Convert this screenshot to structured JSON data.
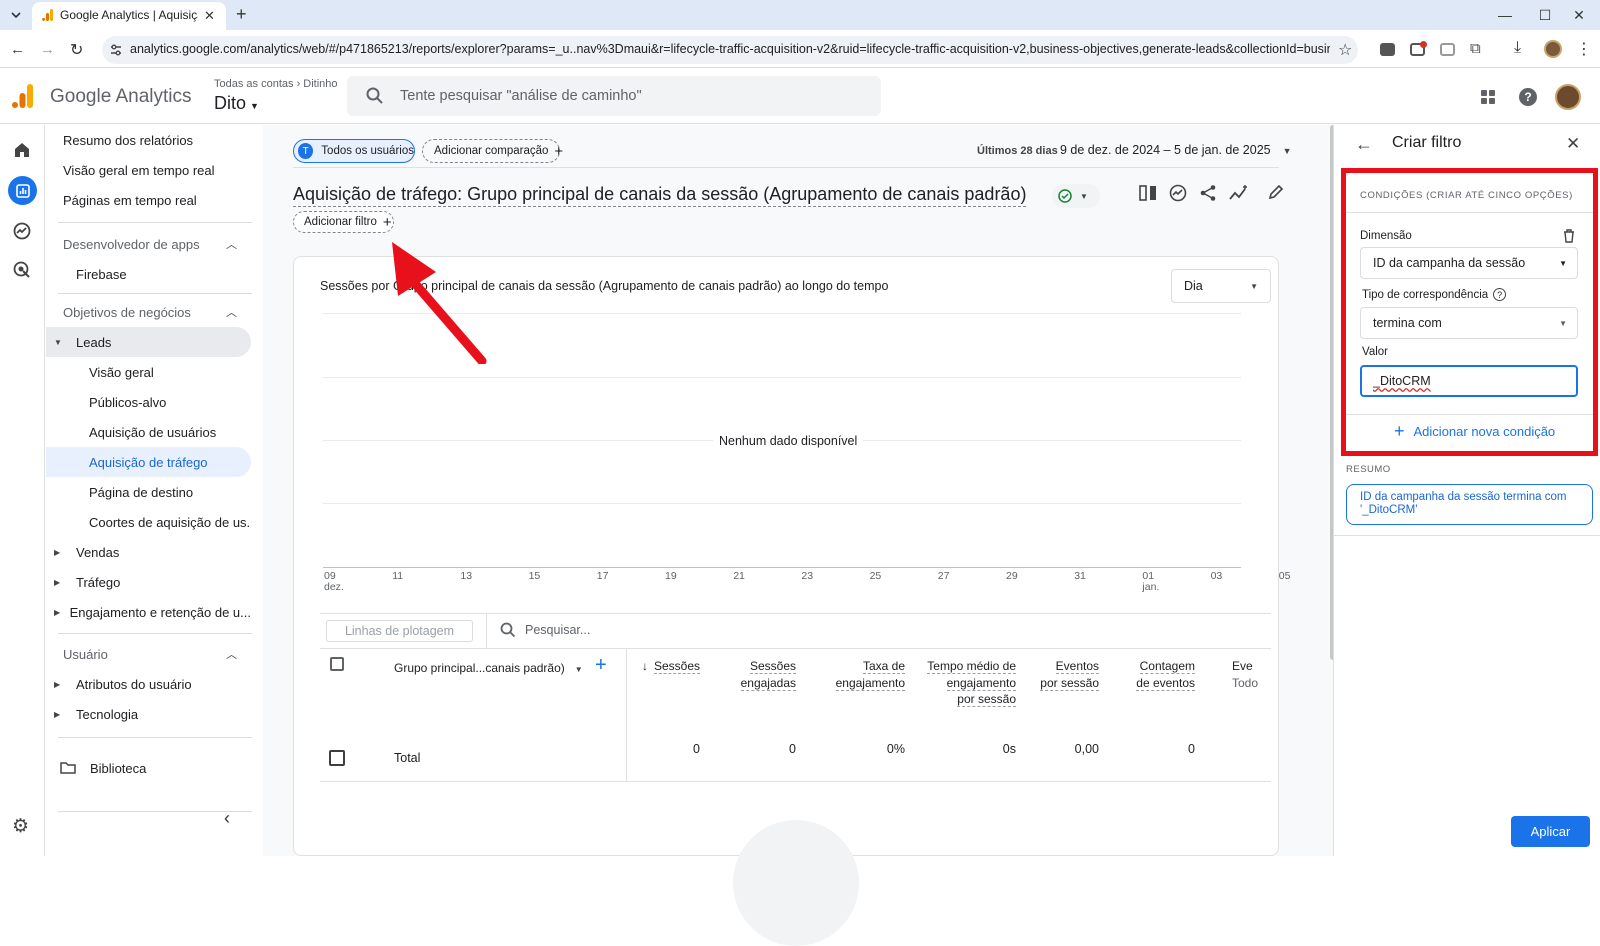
{
  "browser": {
    "tab_title": "Google Analytics | Aquisição de tráfego",
    "url": "analytics.google.com/analytics/web/#/p471865213/reports/explorer?params=_u..nav%3Dmaui&r=lifecycle-traffic-acquisition-v2&ruid=lifecycle-traffic-acquisition-v2,business-objectives,generate-leads&collectionId=business-objec..."
  },
  "header": {
    "product": "Google Analytics",
    "breadcrumb_all": "Todas as contas",
    "breadcrumb_account": "Ditinho",
    "property": "Dito",
    "search_placeholder": "Tente pesquisar \"análise de caminho\""
  },
  "nav": {
    "reports_summary": "Resumo dos relatórios",
    "realtime_overview": "Visão geral em tempo real",
    "realtime_pages": "Páginas em tempo real",
    "app_dev": "Desenvolvedor de apps",
    "firebase": "Firebase",
    "business_objectives": "Objetivos de negócios",
    "leads": "Leads",
    "overview": "Visão geral",
    "audiences": "Públicos-alvo",
    "user_acq": "Aquisição de usuários",
    "traffic_acq": "Aquisição de tráfego",
    "landing_page": "Página de destino",
    "cohorts": "Coortes de aquisição de us...",
    "sales": "Vendas",
    "traffic": "Tráfego",
    "engagement": "Engajamento e retenção de u...",
    "user": "Usuário",
    "user_attrs": "Atributos do usuário",
    "tech": "Tecnologia",
    "library": "Biblioteca"
  },
  "main": {
    "segment_letter": "T",
    "segment": "Todos os usuários",
    "add_comparison": "Adicionar comparação",
    "date_label": "Últimos 28 dias",
    "date_range": "9 de dez. de 2024 – 5 de jan. de 2025",
    "title": "Aquisição de tráfego: Grupo principal de canais da sessão (Agrupamento de canais padrão)",
    "add_filter": "Adicionar filtro",
    "chart_title": "Sessões por Grupo principal de canais da sessão (Agrupamento de canais padrão) ao longo do tempo",
    "granularity": "Dia",
    "no_data": "Nenhum dado disponível",
    "x_ticks": [
      {
        "day": "09",
        "month": "dez."
      },
      {
        "day": "11",
        "month": ""
      },
      {
        "day": "13",
        "month": ""
      },
      {
        "day": "15",
        "month": ""
      },
      {
        "day": "17",
        "month": ""
      },
      {
        "day": "19",
        "month": ""
      },
      {
        "day": "21",
        "month": ""
      },
      {
        "day": "23",
        "month": ""
      },
      {
        "day": "25",
        "month": ""
      },
      {
        "day": "27",
        "month": ""
      },
      {
        "day": "29",
        "month": ""
      },
      {
        "day": "31",
        "month": ""
      },
      {
        "day": "01",
        "month": "jan."
      },
      {
        "day": "03",
        "month": ""
      },
      {
        "day": "05",
        "month": ""
      }
    ],
    "plot_rows": "Linhas de plotagem",
    "table_search_placeholder": "Pesquisar...",
    "dimension_header": "Grupo principal...canais padrão)",
    "columns": [
      {
        "label": "Sessões",
        "total": "0"
      },
      {
        "label": "Sessões engajadas",
        "total": "0"
      },
      {
        "label": "Taxa de engajamento",
        "total": "0%"
      },
      {
        "label": "Tempo médio de engajamento por sessão",
        "total": "0s"
      },
      {
        "label": "Eventos por sessão",
        "total": "0,00"
      },
      {
        "label": "Contagem de eventos",
        "total": "0"
      },
      {
        "label": "Eve",
        "sub": "Todo"
      }
    ],
    "total_label": "Total"
  },
  "panel": {
    "title": "Criar filtro",
    "conditions_header": "CONDIÇÕES (CRIAR ATÉ CINCO OPÇÕES)",
    "dimension_label": "Dimensão",
    "dimension_value": "ID da campanha da sessão",
    "match_type_label": "Tipo de correspondência",
    "match_type_value": "termina com",
    "value_label": "Valor",
    "value_input": "_DitoCRM",
    "add_condition": "Adicionar nova condição",
    "summary_header": "RESUMO",
    "summary_text": "ID da campanha da sessão termina com '_DitoCRM'",
    "apply": "Aplicar"
  },
  "colors": {
    "accent": "#1a73e8",
    "highlight_box": "#e8101b",
    "annotation_arrow": "#e8101b",
    "ga_orange": "#f9ab00",
    "ga_orange_dark": "#e37400"
  }
}
